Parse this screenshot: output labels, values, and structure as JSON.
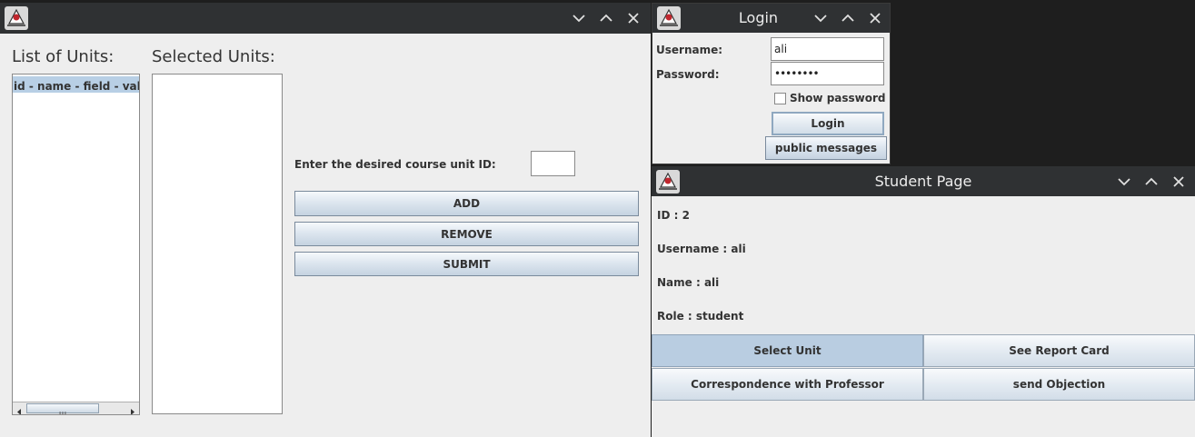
{
  "units_window": {
    "list_label": "List of Units:",
    "selected_label": "Selected Units:",
    "list_items": [
      "id - name - field - vahed"
    ],
    "course_id_label": "Enter the desired course unit ID:",
    "course_id_value": "",
    "add_label": "ADD",
    "remove_label": "REMOVE",
    "submit_label": "SUBMIT"
  },
  "login_window": {
    "title": "Login",
    "username_label": "Username:",
    "username_value": "ali",
    "password_label": "Password:",
    "password_value": "••••••••",
    "show_password_label": "Show password",
    "show_password_checked": false,
    "login_label": "Login",
    "public_messages_label": "public messages"
  },
  "student_window": {
    "title": "Student Page",
    "id_line": "ID : 2",
    "username_line": "Username : ali",
    "name_line": "Name : ali",
    "role_line": "Role : student",
    "select_unit_label": "Select Unit",
    "report_card_label": "See Report Card",
    "correspondence_label": "Correspondence with Professor",
    "objection_label": "send Objection"
  },
  "icons": {
    "app": "java-duke-icon",
    "minimize": "chevron-down-icon",
    "maximize": "chevron-up-icon",
    "close": "close-icon"
  },
  "colors": {
    "titlebar": "#2f3133",
    "window_bg": "#eeeeee",
    "selection": "#b8cfe5"
  }
}
